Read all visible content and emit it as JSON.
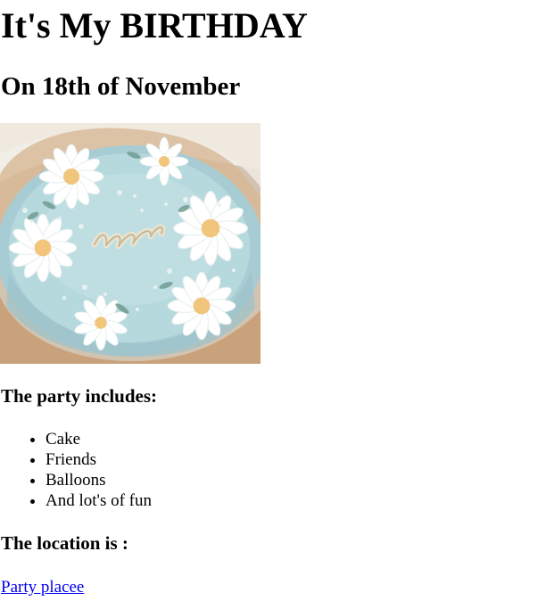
{
  "page": {
    "title": "It's My BIRTHDAY",
    "subtitle": "On 18th of November",
    "cake_icon": "birthday-cake-photo"
  },
  "party": {
    "heading": "The party includes:",
    "items": [
      "Cake",
      "Friends",
      "Balloons",
      "And lot's of fun"
    ]
  },
  "location": {
    "heading": "The location is :",
    "link_text": "Party placee",
    "link_color": "#0000ee"
  }
}
